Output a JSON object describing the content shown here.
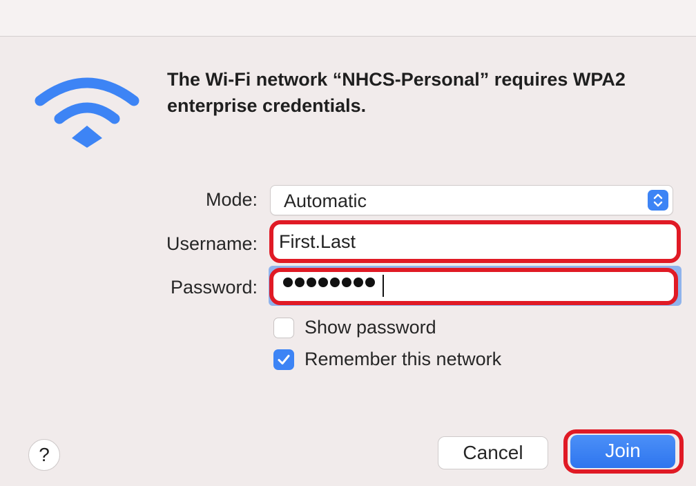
{
  "dialog": {
    "heading": "The Wi-Fi network “NHCS-Personal” requires WPA2 enterprise credentials.",
    "icon": "wifi-icon"
  },
  "form": {
    "mode_label": "Mode:",
    "mode_value": "Automatic",
    "username_label": "Username:",
    "username_value": "First.Last",
    "password_label": "Password:",
    "password_masked_length": 8
  },
  "options": {
    "show_password_label": "Show password",
    "show_password_checked": false,
    "remember_label": "Remember this network",
    "remember_checked": true
  },
  "buttons": {
    "help_label": "?",
    "cancel_label": "Cancel",
    "join_label": "Join"
  },
  "colors": {
    "accent": "#3d84f5",
    "highlight": "#e01a25",
    "background": "#f1ebeb"
  }
}
